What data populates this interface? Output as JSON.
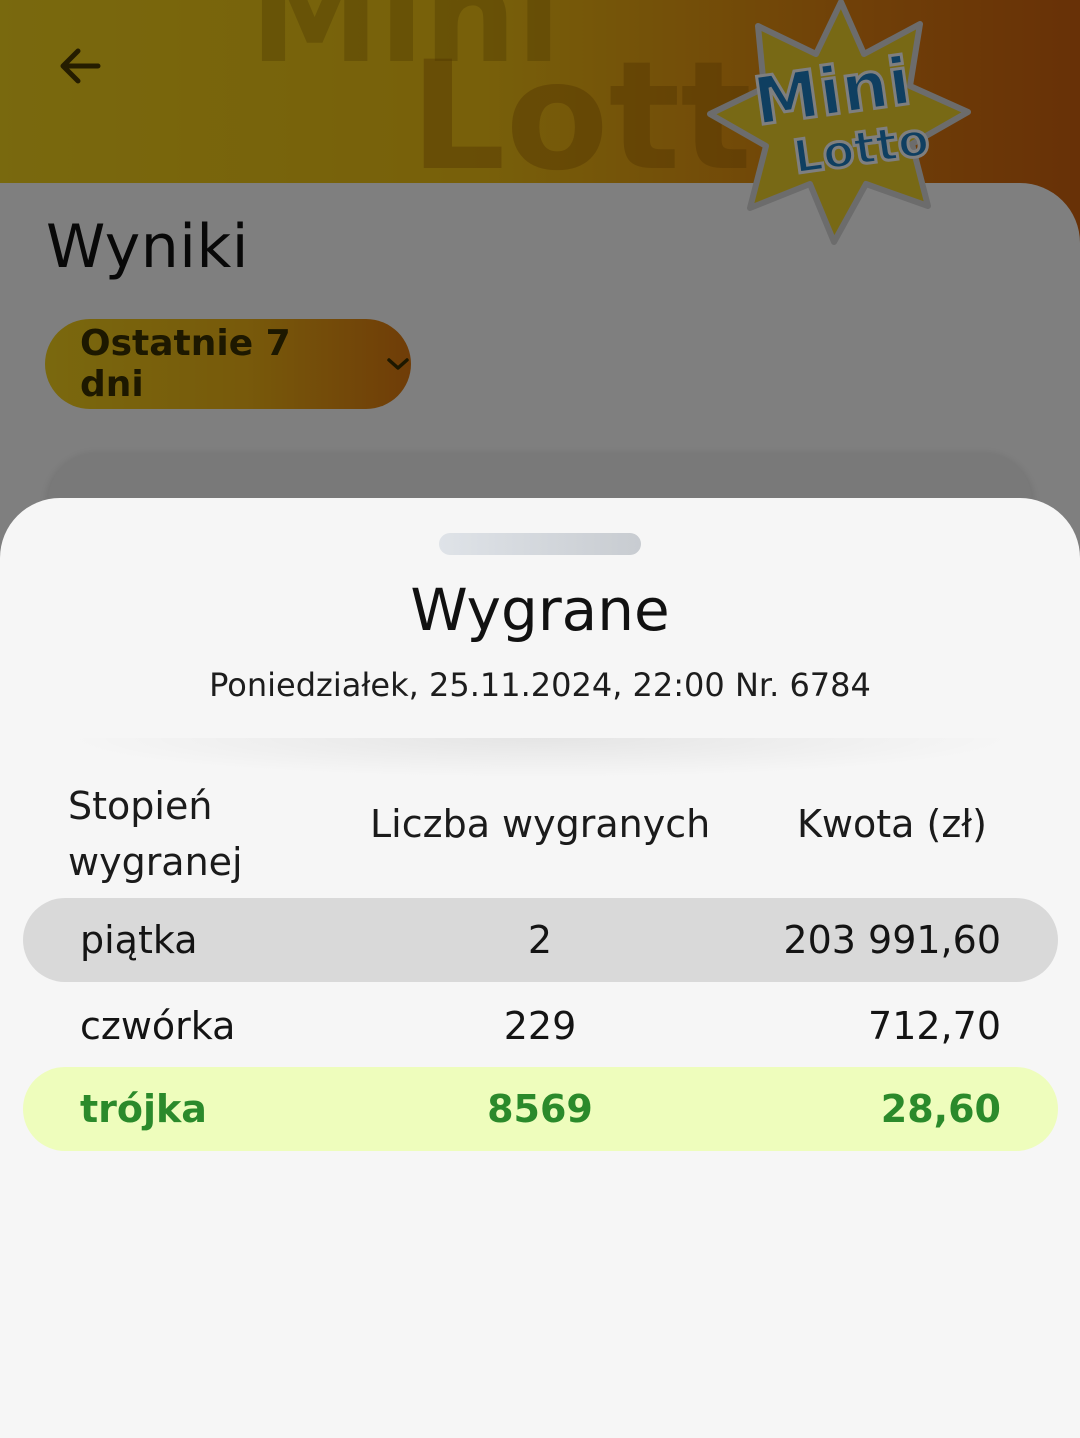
{
  "background": {
    "back_icon": "arrow-left-icon",
    "logo": {
      "line1": "Mini",
      "line2": "Lotto",
      "watermark1": "Mini",
      "watermark2": "Lotto"
    },
    "title": "Wyniki",
    "filter": {
      "label": "Ostatnie 7 dni",
      "icon": "chevron-down-icon"
    }
  },
  "sheet": {
    "title": "Wygrane",
    "subtitle": "Poniedziałek, 25.11.2024, 22:00 Nr. 6784",
    "table": {
      "headers": [
        "Stopień wygranej",
        "Liczba wygranych",
        "Kwota (zł)"
      ],
      "rows": [
        {
          "tier": "piątka",
          "count": "2",
          "amount": "203 991,60"
        },
        {
          "tier": "czwórka",
          "count": "229",
          "amount": "712,70"
        },
        {
          "tier": "trójka",
          "count": "8569",
          "amount": "28,60"
        }
      ]
    }
  },
  "colors": {
    "brand_yellow": "#f3d21c",
    "brand_orange": "#e07f10",
    "highlight_row": "#eefdbc",
    "highlight_text": "#2b8a2b",
    "gray_row": "#d9d9d9"
  }
}
